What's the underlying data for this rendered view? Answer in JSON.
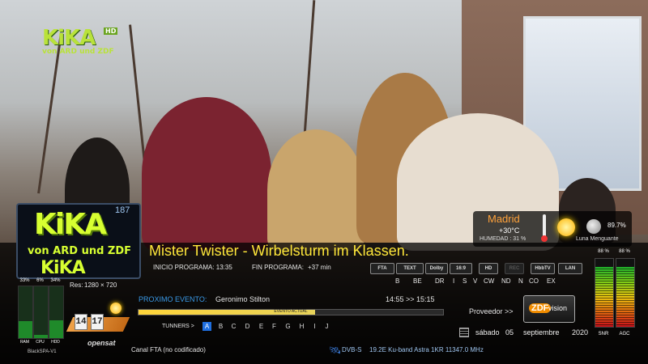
{
  "channel": {
    "logo_text": "KiKA",
    "logo_hd": "HD",
    "logo_sub": "von ARD und ZDF",
    "number": "187",
    "provider_label": "Proveedor >>",
    "provider_logo": "ZDFvision",
    "provider_logo_a": "ZDF",
    "provider_logo_b": "vision"
  },
  "program": {
    "title": "Mister Twister - Wirbelsturm im Klassen.",
    "start_label": "INICIO PROGRAMA: 13:35",
    "end_label": "FIN PROGRAMA:",
    "end_value": "+37 min",
    "next_label": "PROXIMO EVENTO:",
    "next_title": "Geronimo Stilton",
    "next_time": "14:55 >> 15:15",
    "progress_label": "EVENTO ACTUAL",
    "progress": 0.58
  },
  "system": {
    "resolution_label": "Res:",
    "resolution": "1280 × 720",
    "bars": [
      {
        "label": "RAM",
        "pct_text": "33%",
        "pct": 0.33
      },
      {
        "label": "CPU",
        "pct_text": "6%",
        "pct": 0.06
      },
      {
        "label": "HDD",
        "pct_text": "34%",
        "pct": 0.34
      }
    ],
    "skin": "BlackSPA-V1"
  },
  "signal": [
    {
      "label": "SNR",
      "pct_text": "88 %",
      "pct": 0.88
    },
    {
      "label": "AGC",
      "pct_text": "88 %",
      "pct": 0.88
    }
  ],
  "weather": {
    "city": "Madrid",
    "temp": "+30°C",
    "humidity": "HUMEDAD :  31 %",
    "moon_pct": "89.7%",
    "moon_phase": "Luna Menguante"
  },
  "badges": [
    {
      "label": "FTA",
      "active": true
    },
    {
      "label": "TEXT",
      "active": true
    },
    {
      "label": "Dolby",
      "active": true
    },
    {
      "label": "16:9",
      "active": true
    },
    {
      "label": "HD",
      "active": true
    },
    {
      "label": "REC",
      "active": false
    },
    {
      "label": "HbbTV",
      "active": true
    },
    {
      "label": "LAN",
      "active": true
    }
  ],
  "caids": [
    "B",
    "BE",
    "DR",
    "I",
    "S",
    "V",
    "CW",
    "ND",
    "N",
    "CO",
    "EX"
  ],
  "tuners": {
    "label": "TUNNERS >",
    "items": [
      "A",
      "B",
      "C",
      "D",
      "E",
      "F",
      "G",
      "H",
      "I",
      "J"
    ],
    "active": "A"
  },
  "clock": {
    "h": "14",
    "m": "17"
  },
  "date": {
    "weekday": "sábado",
    "day": "05",
    "month": "septiembre",
    "year": "2020"
  },
  "footer": {
    "brand": "opensat",
    "fta": "Canal FTA (no codificado)",
    "dvb": "DVB-S",
    "transponder": "19.2E Ku-band Astra 1KR 11347.0 MHz"
  },
  "colors": {
    "title": "#ffe83a",
    "accent": "#1f6fe0",
    "logo": "#d7ff31"
  }
}
